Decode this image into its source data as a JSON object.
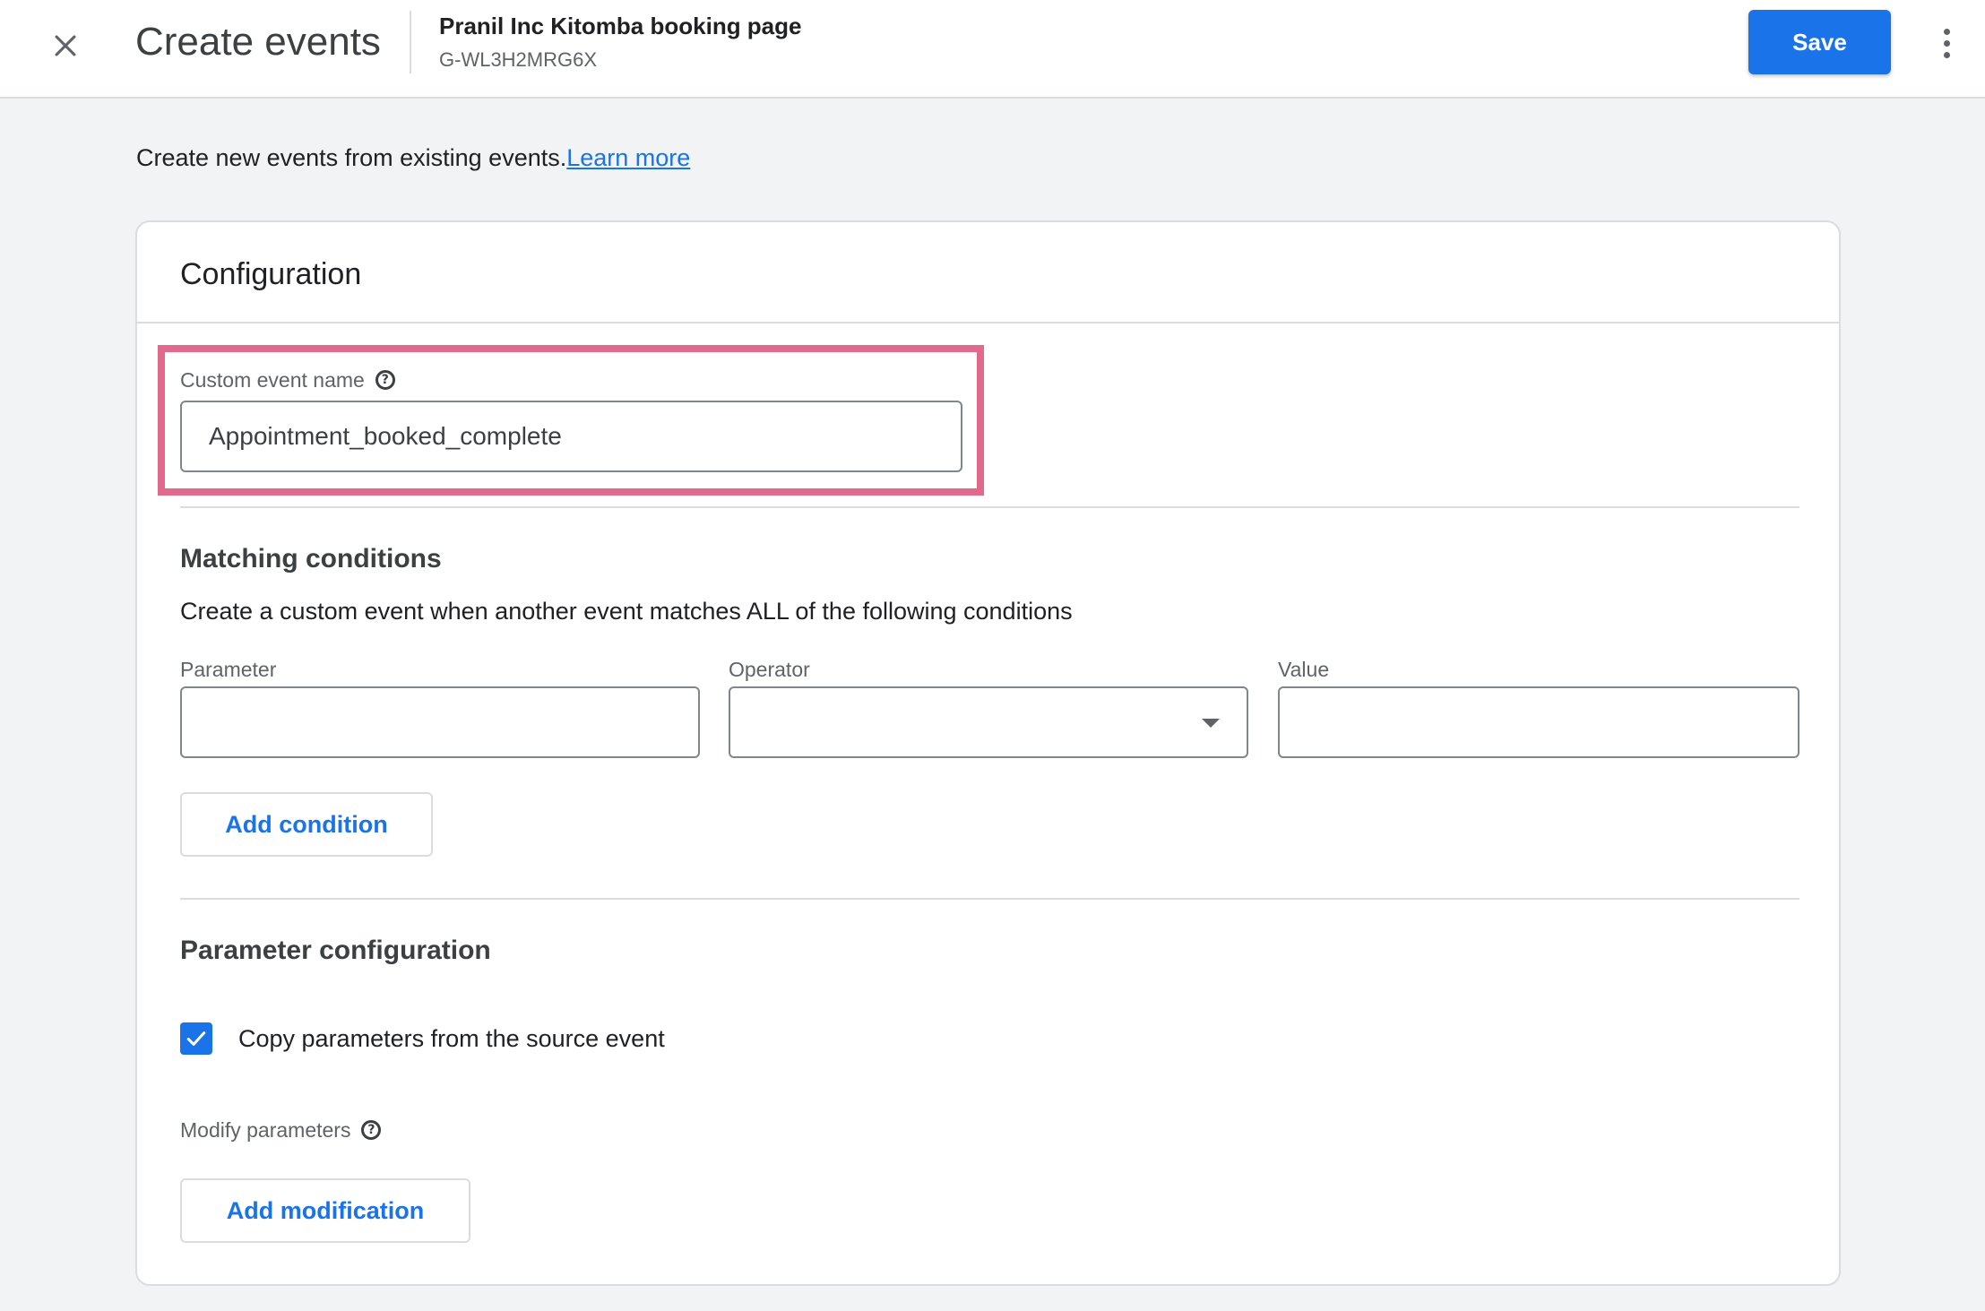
{
  "header": {
    "title": "Create events",
    "property_name": "Pranil Inc Kitomba booking page",
    "property_id": "G-WL3H2MRG6X",
    "save_label": "Save"
  },
  "intro": {
    "text": "Create new events from existing events.",
    "learn_more": "Learn more"
  },
  "configuration": {
    "title": "Configuration",
    "custom_event_name": {
      "label": "Custom event name",
      "value": "Appointment_booked_complete"
    },
    "matching_conditions": {
      "heading": "Matching conditions",
      "description": "Create a custom event when another event matches ALL of the following conditions",
      "parameter_label": "Parameter",
      "parameter_value": "",
      "operator_label": "Operator",
      "operator_value": "",
      "value_label": "Value",
      "value_value": "",
      "add_condition_label": "Add condition"
    },
    "parameter_configuration": {
      "heading": "Parameter configuration",
      "copy_parameters_label": "Copy parameters from the source event",
      "copy_parameters_checked": true,
      "modify_parameters_label": "Modify parameters",
      "add_modification_label": "Add modification"
    }
  },
  "colors": {
    "accent": "#1a73e8",
    "highlight_border": "#e0698c"
  },
  "icons": {
    "close": "close-icon",
    "more": "more-vert-icon",
    "help": "help-icon",
    "dropdown": "arrow-drop-down-icon",
    "checkbox": "check-icon"
  }
}
